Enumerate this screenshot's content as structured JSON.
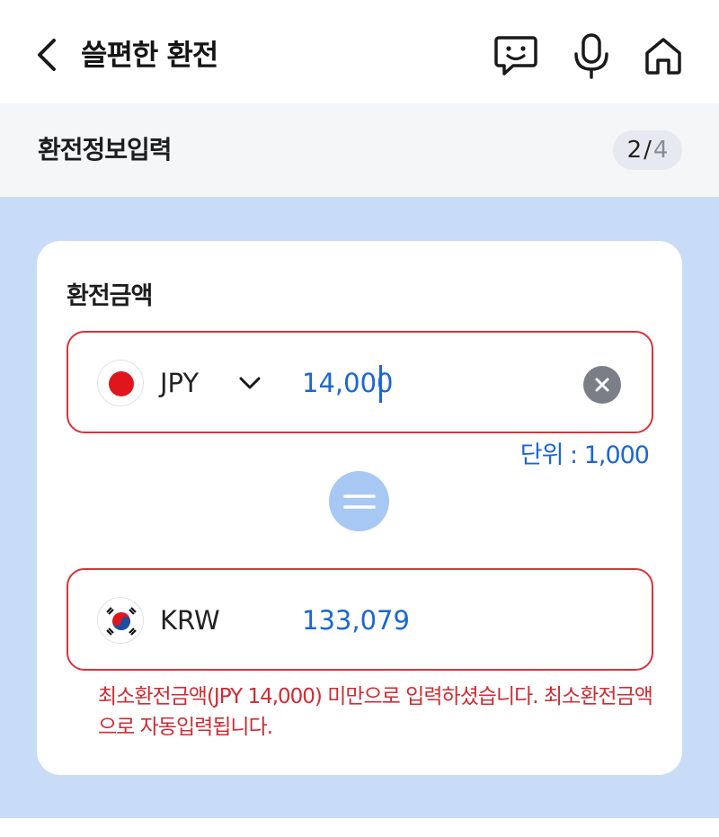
{
  "header": {
    "title": "쓸편한 환전",
    "icons": [
      "chevron-left-icon",
      "chat-smile-icon",
      "microphone-icon",
      "home-icon"
    ]
  },
  "step": {
    "title": "환전정보입력",
    "current": "2",
    "separator": "/",
    "total": "4"
  },
  "exchange": {
    "label": "환전금액",
    "from": {
      "currency": "JPY",
      "value": "14,000",
      "flag": "japan-flag-icon"
    },
    "unit_text": "단위 : 1,000",
    "to": {
      "currency": "KRW",
      "value": "133,079",
      "flag": "korea-flag-icon"
    },
    "error": "최소환전금액(JPY 14,000) 미만으로 입력하셨습니다. 최소환전금액으로 자동입력됩니다."
  },
  "colors": {
    "accent": "#1a66d6",
    "error": "#d8323b",
    "background": "#c8dcf8",
    "equal_circle": "#a8c8f4"
  }
}
